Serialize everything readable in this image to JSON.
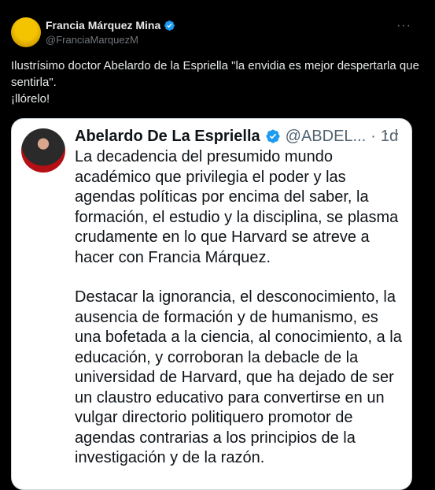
{
  "tweet": {
    "author_name": "Francia Márquez Mina",
    "author_handle": "@FranciaMarquezM",
    "more": "···",
    "text_line1": "Ilustrísimo doctor Abelardo de la Espriella \"la envidia es mejor despertarla que sentirla\".",
    "text_line2": "¡llórelo!"
  },
  "quote": {
    "author_name": "Abelardo De La Espriella",
    "author_handle": "@ABDEL...",
    "separator": "·",
    "time": "1d",
    "more": "···",
    "paragraph1": "La decadencia del presumido mundo académico que privilegia el poder y las agendas políticas por encima del saber, la formación, el estudio y la disciplina, se plasma crudamente en lo que Harvard se atreve a hacer con Francia Márquez.",
    "paragraph2": "Destacar la ignorancia, el desconocimiento, la ausencia de formación y de humanismo, es una bofetada a la ciencia, al conocimiento, a la educación, y corroboran la debacle de la universidad de Harvard, que ha dejado de ser un claustro educativo para convertirse en un vulgar directorio politiquero promotor de agendas contrarias a los principios de la investigación y de la razón."
  },
  "colors": {
    "background": "#000000",
    "verified": "#1d9bf0",
    "quote_bg": "#ffffff"
  }
}
